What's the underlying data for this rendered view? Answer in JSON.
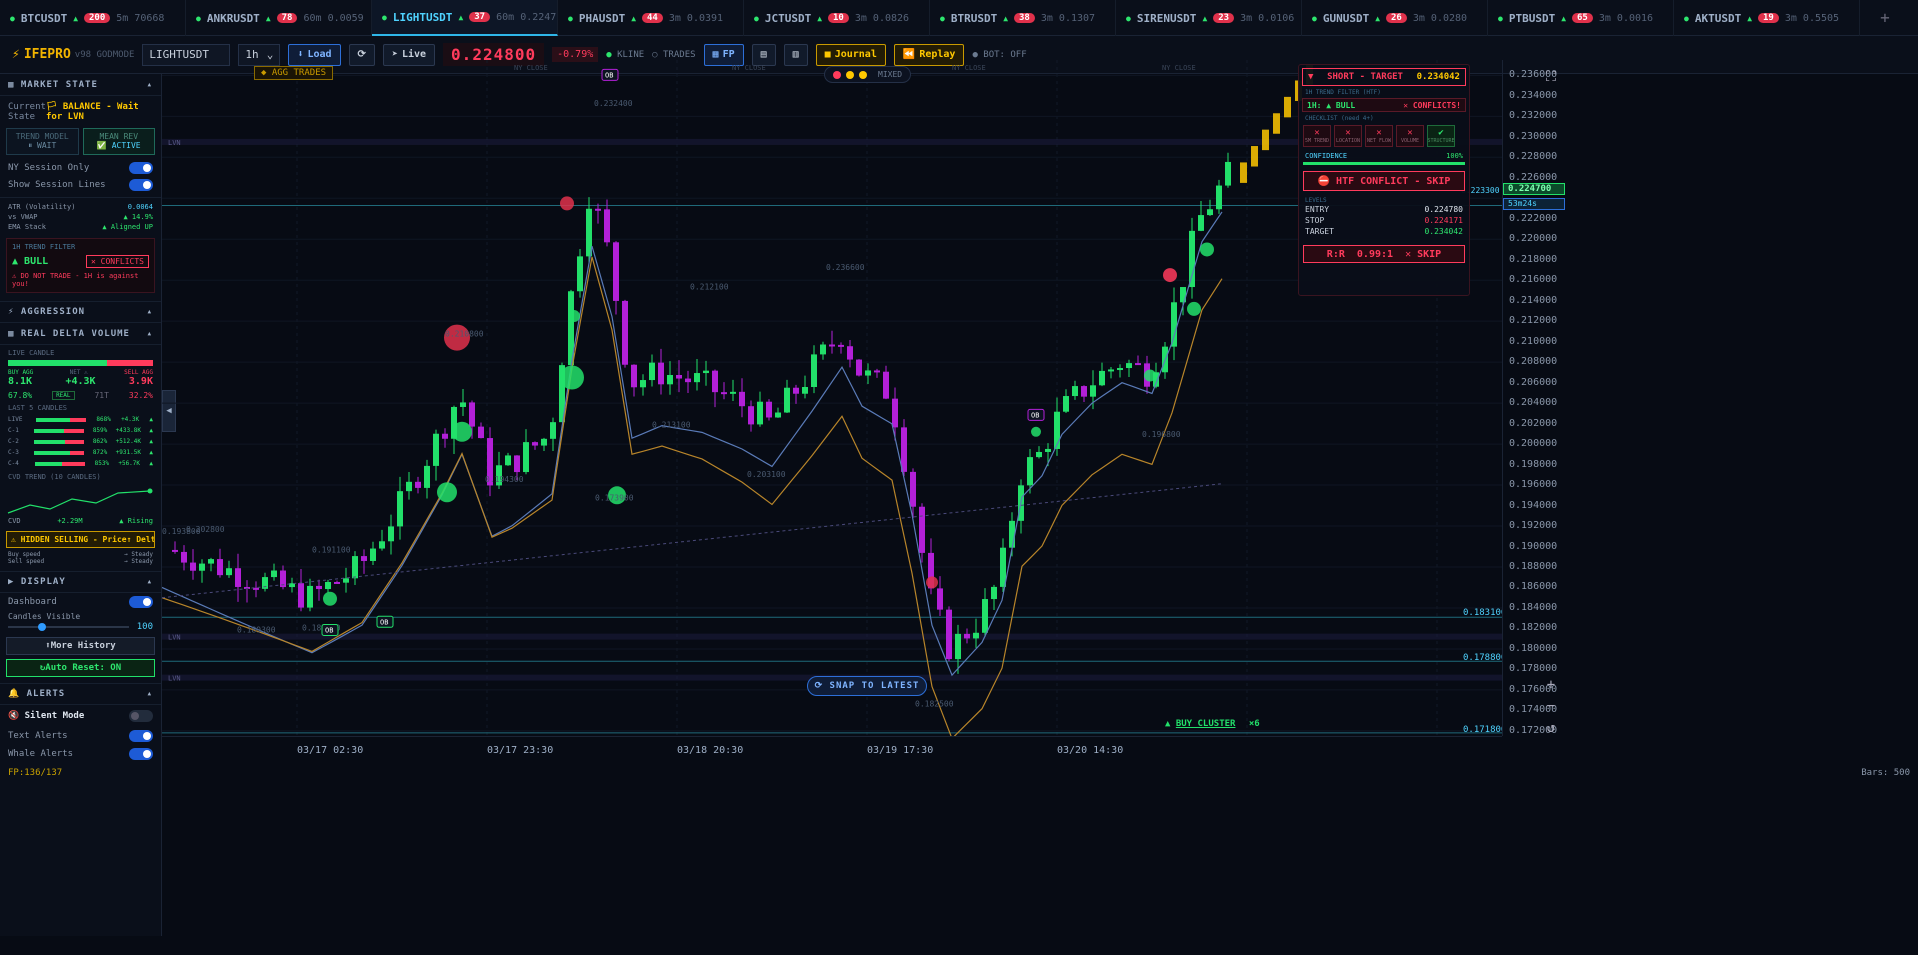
{
  "tabs": [
    {
      "sym": "BTCUSDT",
      "badge": "200",
      "meta": "5m 70668"
    },
    {
      "sym": "ANKRUSDT",
      "badge": "78",
      "meta": "60m 0.0059"
    },
    {
      "sym": "LIGHTUSDT",
      "badge": "37",
      "meta": "60m 0.2247"
    },
    {
      "sym": "PHAUSDT",
      "badge": "44",
      "meta": "3m 0.0391"
    },
    {
      "sym": "JCTUSDT",
      "badge": "10",
      "meta": "3m 0.0826"
    },
    {
      "sym": "BTRUSDT",
      "badge": "38",
      "meta": "3m 0.1307"
    },
    {
      "sym": "SIRENUSDT",
      "badge": "23",
      "meta": "3m 0.0106"
    },
    {
      "sym": "GUNUSDT",
      "badge": "26",
      "meta": "3m 0.0280"
    },
    {
      "sym": "PTBUSDT",
      "badge": "65",
      "meta": "3m 0.0016"
    },
    {
      "sym": "AKTUSDT",
      "badge": "19",
      "meta": "3m 0.5505"
    }
  ],
  "toolbar": {
    "logo": "IFEPRO",
    "version": "v98 GODMODE",
    "symbol": "LIGHTUSDT",
    "interval": "1h",
    "load": "Load",
    "live": "Live",
    "price": "0.224800",
    "change": "-0.79%",
    "kline": "KLINE",
    "trades": "TRADES",
    "fp": "FP",
    "journal": "Journal",
    "replay": "Replay",
    "bot": "BOT: OFF"
  },
  "market": {
    "title": "MARKET STATE",
    "state_label": "Current State",
    "state_value": "BALANCE - Wait for LVN",
    "trend_model": "TREND MODEL",
    "trend_val": "WAIT",
    "mean_rev": "MEAN REV",
    "mean_val": "ACTIVE",
    "ny": "NY Session Only",
    "lines": "Show Session Lines",
    "atr": "ATR (Volatility)",
    "atr_v": "0.0064",
    "vwap": "vs VWAP",
    "vwap_v": "14.9%",
    "ema": "EMA Stack",
    "ema_v": "Aligned UP",
    "filter": "1H TREND FILTER",
    "bull": "BULL",
    "conflicts": "CONFLICTS",
    "warn": "DO NOT TRADE - 1H is against you!"
  },
  "aggression": {
    "title": "AGGRESSION"
  },
  "delta": {
    "title": "REAL DELTA VOLUME",
    "live": "LIVE CANDLE",
    "buy": "BUY AGG",
    "net": "NET",
    "sell": "SELL AGG",
    "buy_v": "8.1K",
    "net_v": "+4.3K",
    "sell_v": "3.9K",
    "buy_pct": "67.8%",
    "real": "REAL",
    "trades": "71T",
    "sell_pct": "32.2%",
    "last5": "LAST 5 CANDLES",
    "rows": [
      {
        "l": "LIVE",
        "p": "868%",
        "v": "+4.3K",
        "f": 0.68
      },
      {
        "l": "C-1",
        "p": "859%",
        "v": "+433.8K",
        "f": 0.59
      },
      {
        "l": "C-2",
        "p": "862%",
        "v": "+512.4K",
        "f": 0.62
      },
      {
        "l": "C-3",
        "p": "872%",
        "v": "+931.5K",
        "f": 0.72
      },
      {
        "l": "C-4",
        "p": "853%",
        "v": "+56.7K",
        "f": 0.53
      }
    ],
    "cvd_title": "CVD TREND (10 CANDLES)",
    "cvd": "CVD",
    "cvd_v": "+2.29M",
    "rising": "Rising",
    "hidden": "HIDDEN SELLING - Price↑ Delta↓",
    "buy_speed": "Buy speed",
    "sell_speed": "Sell speed",
    "steady": "→ Steady"
  },
  "display": {
    "title": "DISPLAY",
    "dashboard": "Dashboard",
    "visible": "Candles Visible",
    "visible_v": "100",
    "more": "More History",
    "reset": "Auto Reset: ON"
  },
  "alerts": {
    "title": "ALERTS",
    "silent": "Silent Mode",
    "text": "Text Alerts",
    "whale": "Whale Alerts"
  },
  "chart": {
    "agg": "AGG TRADES",
    "mixed": "MIXED",
    "snap": "SNAP TO LATEST",
    "buy_cluster": "BUY CLUSTER",
    "cluster_n": "×6",
    "ny_close": "NY CLOSE",
    "ob": "OB",
    "lvn": "LVN",
    "level_a": "0.223300",
    "level_b": "0.183100",
    "level_c": "0.178800",
    "level_d": "0.171800",
    "cur_price": "0.224700",
    "countdown": "53m24s",
    "bars": "Bars: 500",
    "box_labels": [
      "0.210800",
      "0.194300",
      "0.212100",
      "0.236600",
      "0.232400",
      "0.213100",
      "0.203100",
      "0.196800",
      "0.202800",
      "0.191100",
      "0.189300",
      "0.182400",
      "0.182500",
      "0.173900",
      "0.193800"
    ]
  },
  "panel": {
    "title": "SHORT - TARGET",
    "target": "0.234042",
    "htf": "1H TREND FILTER (HTF)",
    "bull": "1H: ▲ BULL",
    "conf": "CONFLICTS!",
    "checklist": "CHECKLIST (need 4+)",
    "checks": [
      {
        "n": "5M TREND",
        "ok": false
      },
      {
        "n": "LOCATION",
        "ok": false
      },
      {
        "n": "NET FLOW",
        "ok": false
      },
      {
        "n": "VOLUME",
        "ok": false
      },
      {
        "n": "STRUCTURE",
        "ok": true
      }
    ],
    "confidence": "CONFIDENCE",
    "conf_v": "100%",
    "htf_skip": "HTF CONFLICT - SKIP",
    "levels": "LEVELS",
    "entry": "ENTRY",
    "entry_v": "0.224780",
    "stop": "STOP",
    "stop_v": "0.224171",
    "target_l": "TARGET",
    "target_v": "0.234042",
    "rr": "R:R  0.99:1  ✕ SKIP"
  },
  "axis": {
    "y": [
      "0.236000",
      "0.234000",
      "0.232000",
      "0.230000",
      "0.228000",
      "0.226000",
      "0.222000",
      "0.220000",
      "0.218000",
      "0.216000",
      "0.214000",
      "0.212000",
      "0.210000",
      "0.208000",
      "0.206000",
      "0.204000",
      "0.202000",
      "0.200000",
      "0.198000",
      "0.196000",
      "0.194000",
      "0.192000",
      "0.190000",
      "0.188000",
      "0.186000",
      "0.184000",
      "0.182000",
      "0.180000",
      "0.178000",
      "0.176000",
      "0.174000",
      "0.172000"
    ],
    "x": [
      "03/17 02:30",
      "03/17 23:30",
      "03/18 20:30",
      "03/19 17:30",
      "03/20 14:30"
    ]
  },
  "status": {
    "fp": "FP:136/137"
  },
  "colors": {
    "up": "#22e06a",
    "down": "#b320d8",
    "accent": "#4fd3ff",
    "gold": "#ffc800",
    "danger": "#ff3b5c"
  }
}
